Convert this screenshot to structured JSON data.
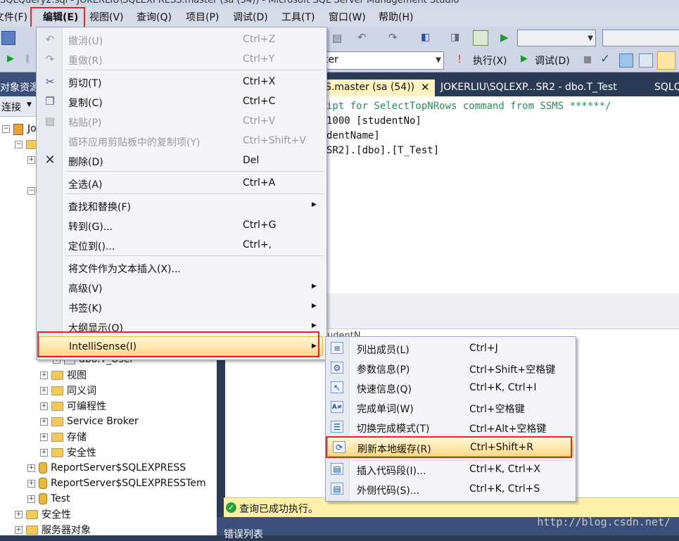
{
  "window": {
    "title": "SQLQuery2.sql - JOKERLIU\\SQLEXPRESS.master (sa (54)) - Microsoft SQL Server Management Studio"
  },
  "menubar": [
    "文件(F)",
    "编辑(E)",
    "视图(V)",
    "查询(Q)",
    "项目(P)",
    "调试(D)",
    "工具(T)",
    "窗口(W)",
    "帮助(H)"
  ],
  "toolbar": {
    "db_combo": "ter",
    "execute": "执行(X)",
    "debug": "调试(D)"
  },
  "explorer": {
    "title": "对象资源",
    "connect": "连接",
    "items": [
      "Jo",
      "dbo.T_User",
      "视图",
      "同义词",
      "可编程性",
      "Service Broker",
      "存储",
      "安全性",
      "ReportServer$SQLEXPRESS",
      "ReportServer$SQLEXPRESSTem",
      "Test",
      "安全性",
      "服务器对象"
    ]
  },
  "tabs": {
    "active": "S.master (sa (54))",
    "inactive1": "JOKERLIU\\SQLEXP...SR2 - dbo.T_Test",
    "inactive2": "SQLQ"
  },
  "editor": {
    "lines": [
      "ipt for SelectTopNRows command from SSMS  ******/",
      "1000 [studentNo]",
      "dentName]",
      "SR2].[dbo].[T_Test]"
    ]
  },
  "results": {
    "column_fragment": "udentN"
  },
  "status": {
    "text": "查询已成功执行。"
  },
  "errorlist": {
    "title": "错误列表"
  },
  "watermark": "http://blog.csdn.net/",
  "edit_menu": {
    "items": [
      {
        "label": "撤消(U)",
        "shortcut": "Ctrl+Z",
        "icon": "undo-icon"
      },
      {
        "label": "重做(R)",
        "shortcut": "Ctrl+Y",
        "icon": "redo-icon"
      },
      {
        "label": "剪切(T)",
        "shortcut": "Ctrl+X",
        "icon": "scissors-icon"
      },
      {
        "label": "复制(C)",
        "shortcut": "Ctrl+C",
        "icon": "copy-icon"
      },
      {
        "label": "粘贴(P)",
        "shortcut": "Ctrl+V",
        "icon": "paste-icon"
      },
      {
        "label": "循环应用剪贴板中的复制项(Y)",
        "shortcut": "Ctrl+Shift+V"
      },
      {
        "label": "删除(D)",
        "shortcut": "Del",
        "icon": "delete-icon"
      },
      {
        "label": "全选(A)",
        "shortcut": "Ctrl+A"
      },
      {
        "label": "查找和替换(F)",
        "shortcut": ""
      },
      {
        "label": "转到(G)...",
        "shortcut": "Ctrl+G"
      },
      {
        "label": "定位到()...",
        "shortcut": "Ctrl+,"
      },
      {
        "label": "将文件作为文本插入(X)...",
        "shortcut": ""
      },
      {
        "label": "高级(V)",
        "shortcut": ""
      },
      {
        "label": "书签(K)",
        "shortcut": ""
      },
      {
        "label": "大纲显示(O)",
        "shortcut": ""
      },
      {
        "label": "IntelliSense(I)",
        "shortcut": ""
      }
    ]
  },
  "intellisense_menu": {
    "items": [
      {
        "label": "列出成员(L)",
        "shortcut": "Ctrl+J"
      },
      {
        "label": "参数信息(P)",
        "shortcut": "Ctrl+Shift+空格键"
      },
      {
        "label": "快速信息(Q)",
        "shortcut": "Ctrl+K, Ctrl+I"
      },
      {
        "label": "完成单词(W)",
        "shortcut": "Ctrl+空格键"
      },
      {
        "label": "切换完成模式(T)",
        "shortcut": "Ctrl+Alt+空格键"
      },
      {
        "label": "刷新本地缓存(R)",
        "shortcut": "Ctrl+Shift+R"
      },
      {
        "label": "插入代码段(I)...",
        "shortcut": "Ctrl+K, Ctrl+X"
      },
      {
        "label": "外侧代码(S)...",
        "shortcut": "Ctrl+K, Ctrl+S"
      }
    ]
  },
  "colors": {
    "highlight_red": "#e2262a",
    "menu_hover": "#ffd98a",
    "ide_blue": "#2b3a55"
  }
}
